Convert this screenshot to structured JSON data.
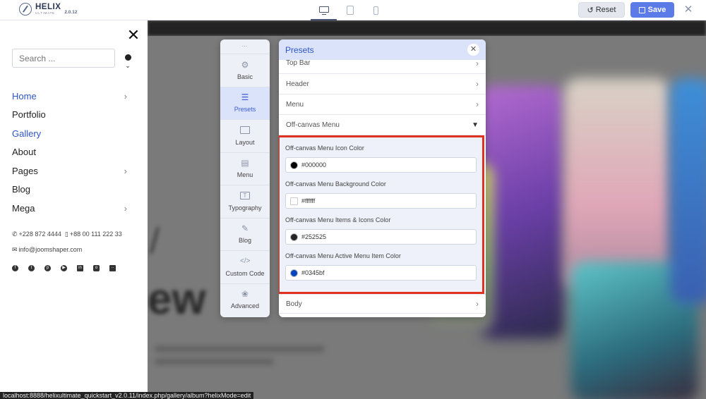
{
  "app": {
    "name": "HELIX",
    "subtitle": "ULTIMATE",
    "version": "2.0.12"
  },
  "toolbar": {
    "reset_label": "Reset",
    "save_label": "Save"
  },
  "offcanvas": {
    "search_placeholder": "Search ...",
    "menu": [
      {
        "label": "Home",
        "has_children": true,
        "active": true
      },
      {
        "label": "Portfolio",
        "has_children": false,
        "active": false
      },
      {
        "label": "Gallery",
        "has_children": false,
        "active": true
      },
      {
        "label": "About",
        "has_children": false,
        "active": false
      },
      {
        "label": "Pages",
        "has_children": true,
        "active": false
      },
      {
        "label": "Blog",
        "has_children": false,
        "active": false
      },
      {
        "label": "Mega",
        "has_children": true,
        "active": false
      }
    ],
    "phone1": "+228 872 4444",
    "phone2": "+88 00 111 222 33",
    "email": "info@joomshaper.com",
    "social_icons": [
      "facebook-icon",
      "twitter-icon",
      "pinterest-icon",
      "youtube-icon",
      "linkedin-icon",
      "instagram-icon",
      "flickr-icon"
    ]
  },
  "status_url": "localhost:8888/helixultimate_quickstart_v2.0.11/index.php/gallery/album?helixMode=edit",
  "preview": {
    "headline_fragment": "ew"
  },
  "sidenav": {
    "items": [
      {
        "label": "Basic",
        "icon": "gear-icon"
      },
      {
        "label": "Presets",
        "icon": "sliders-icon"
      },
      {
        "label": "Layout",
        "icon": "layout-icon"
      },
      {
        "label": "Menu",
        "icon": "list-icon"
      },
      {
        "label": "Typography",
        "icon": "text-icon"
      },
      {
        "label": "Blog",
        "icon": "edit-icon"
      },
      {
        "label": "Custom Code",
        "icon": "code-icon"
      },
      {
        "label": "Advanced",
        "icon": "settings-advanced-icon"
      }
    ]
  },
  "panel": {
    "title": "Presets",
    "sections": {
      "top_bar": "Top Bar",
      "header": "Header",
      "menu": "Menu",
      "offcanvas": "Off-canvas Menu",
      "body": "Body"
    },
    "fields": [
      {
        "label": "Off-canvas Menu Icon Color",
        "value": "#000000",
        "swatch": "#000000"
      },
      {
        "label": "Off-canvas Menu Background Color",
        "value": "#ffffff",
        "swatch": "#ffffff"
      },
      {
        "label": "Off-canvas Menu Items & Icons Color",
        "value": "#252525",
        "swatch": "#252525"
      },
      {
        "label": "Off-canvas Menu Active Menu Item Color",
        "value": "#0345bf",
        "swatch": "#0345bf"
      }
    ]
  },
  "colors": {
    "accent": "#5b7be9",
    "active_link": "#2e56c3",
    "highlight_border": "#e0321f"
  }
}
